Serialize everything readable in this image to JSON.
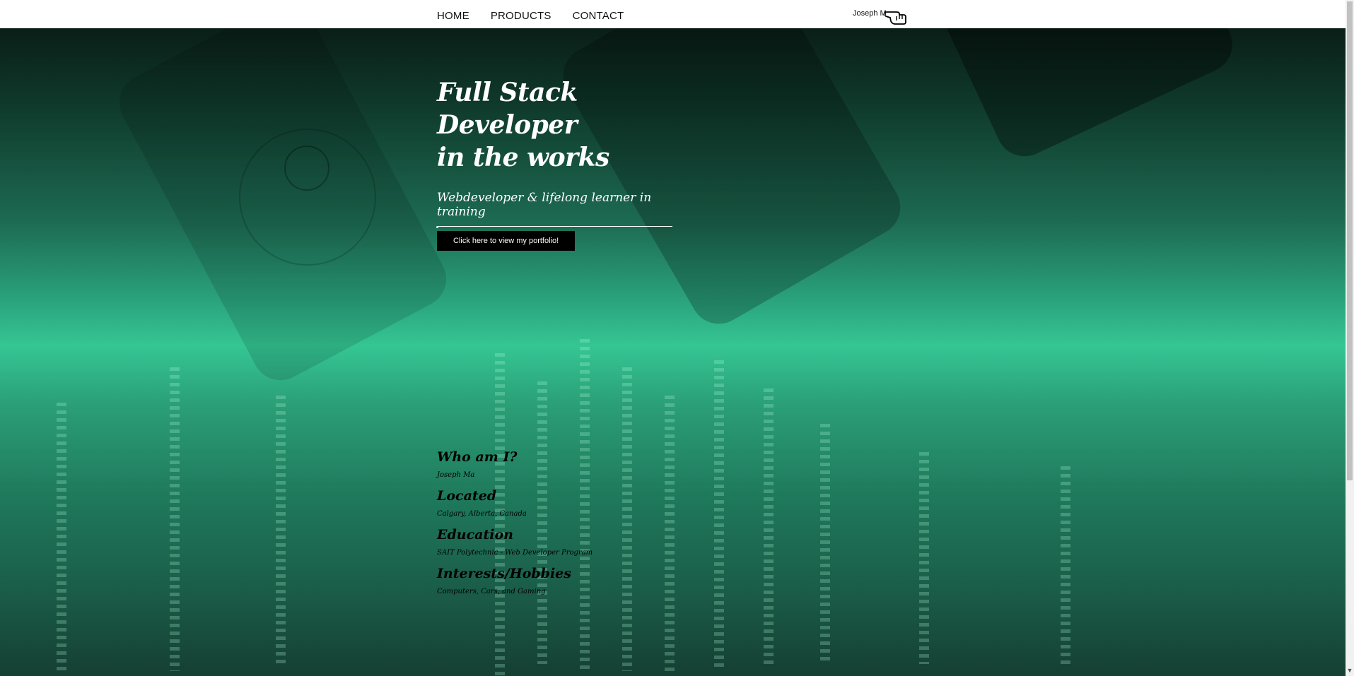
{
  "nav": {
    "links": [
      "HOME",
      "PRODUCTS",
      "CONTACT"
    ],
    "brand": "Joseph M",
    "brand_icon": "pointing-hand-icon"
  },
  "hero": {
    "title_line1": "Full Stack Developer",
    "title_line2": "in the works",
    "subtitle": "Webdeveloper & lifelong learner in training",
    "button_label": "Click here to view my portfolio!"
  },
  "about": [
    {
      "heading": "Who am I?",
      "text": "Joseph Ma"
    },
    {
      "heading": "Located",
      "text": "Calgary, Alberta, Canada"
    },
    {
      "heading": "Education",
      "text": "SAIT Polytechnic - Web Developer Program"
    },
    {
      "heading": "Interests/Hobbies",
      "text": "Computers, Cars, and Gaming"
    }
  ],
  "colors": {
    "accent_green": "#35c694",
    "nav_bg": "#ffffff",
    "button_bg": "#000000"
  }
}
